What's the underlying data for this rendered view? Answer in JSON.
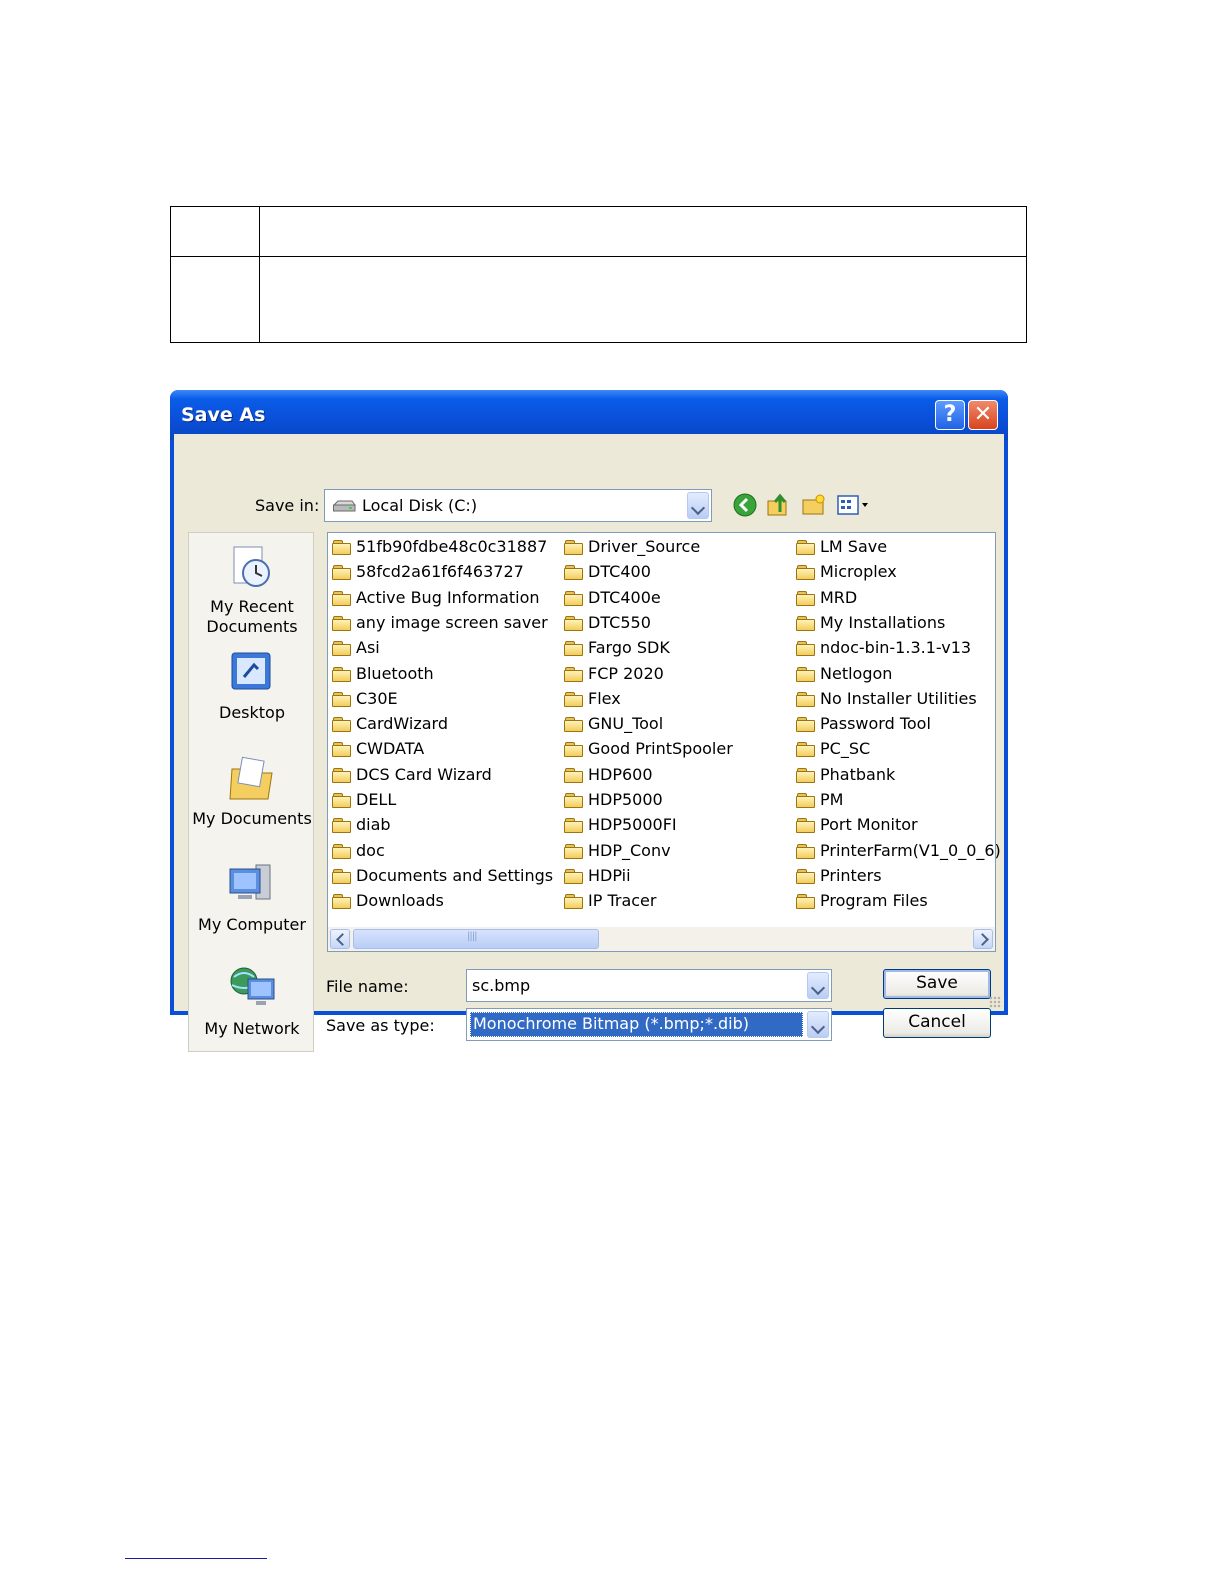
{
  "dialog": {
    "title": "Save As",
    "help_glyph": "?",
    "close_glyph": "✕"
  },
  "toolbar": {
    "save_in_label": "Save in:",
    "save_in_value": "Local Disk (C:)",
    "icons": [
      "back-icon",
      "up-folder-icon",
      "new-folder-icon",
      "views-menu-icon"
    ]
  },
  "places": [
    {
      "label_line1": "My Recent",
      "label_line2": "Documents",
      "icon": "recent-documents-icon"
    },
    {
      "label_line1": "Desktop",
      "label_line2": "",
      "icon": "desktop-icon"
    },
    {
      "label_line1": "My Documents",
      "label_line2": "",
      "icon": "my-documents-icon"
    },
    {
      "label_line1": "My Computer",
      "label_line2": "",
      "icon": "my-computer-icon"
    },
    {
      "label_line1": "My Network",
      "label_line2": "",
      "icon": "my-network-icon"
    }
  ],
  "files": {
    "col1": [
      "51fb90fdbe48c0c31887",
      "58fcd2a61f6f463727",
      "Active Bug Information",
      "any image screen saver",
      "Asi",
      "Bluetooth",
      "C30E",
      "CardWizard",
      "CWDATA",
      "DCS Card Wizard",
      "DELL",
      "diab",
      "doc",
      "Documents and Settings",
      "Downloads"
    ],
    "col2": [
      "Driver_Source",
      "DTC400",
      "DTC400e",
      "DTC550",
      "Fargo SDK",
      "FCP 2020",
      "Flex",
      "GNU_Tool",
      "Good PrintSpooler",
      "HDP600",
      "HDP5000",
      "HDP5000FI",
      "HDP_Conv",
      "HDPii",
      "IP Tracer"
    ],
    "col3": [
      "LM Save",
      "Microplex",
      "MRD",
      "My Installations",
      "ndoc-bin-1.3.1-v13",
      "Netlogon",
      "No Installer Utilities",
      "Password Tool",
      "PC_SC",
      "Phatbank",
      "PM",
      "Port Monitor",
      "PrinterFarm(V1_0_0_6)",
      "Printers",
      "Program Files"
    ]
  },
  "form": {
    "file_name_label": "File name:",
    "file_name_value": "sc.bmp",
    "save_as_type_label": "Save as type:",
    "save_as_type_value": "Monochrome Bitmap (*.bmp;*.dib)",
    "save_button": "Save",
    "cancel_button": "Cancel"
  },
  "colors": {
    "titlebar": "#0a4fd8",
    "dialog_face": "#ece9d8",
    "selection": "#316ac5"
  }
}
